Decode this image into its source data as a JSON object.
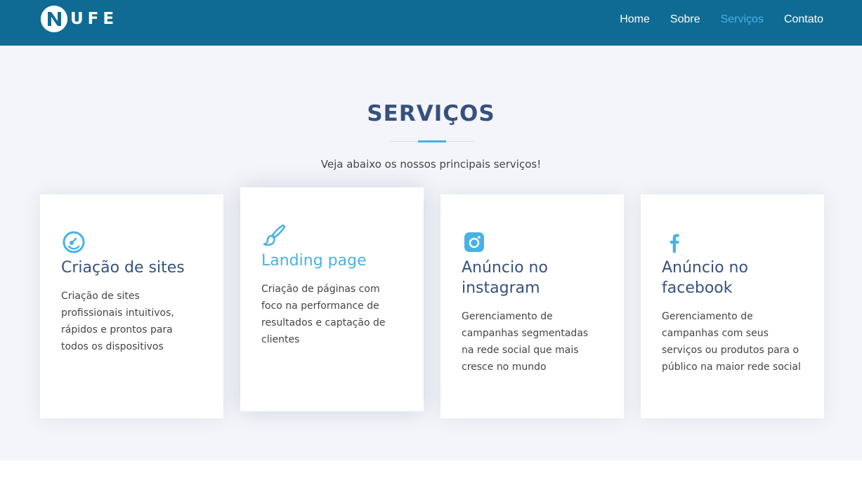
{
  "brand": {
    "name": "UFE",
    "mark_letter": "N"
  },
  "nav": {
    "items": [
      {
        "label": "Home"
      },
      {
        "label": "Sobre"
      },
      {
        "label": "Serviços",
        "active": true
      },
      {
        "label": "Contato"
      }
    ]
  },
  "services": {
    "title": "SERVIÇOS",
    "subtitle": "Veja abaixo os nossos principais serviços!",
    "cards": [
      {
        "icon": "dashboard-gauge-icon",
        "title": "Criação de sites",
        "text": "Criação de sites profissionais intuitivos, rápidos e prontos para todos os dispositivos"
      },
      {
        "icon": "paintbrush-icon",
        "title": "Landing page",
        "text": "Criação de páginas com foco na performance de resultados e captação de clientes"
      },
      {
        "icon": "instagram-icon",
        "title": "Anúncio no instagram",
        "text": "Gerenciamento de campanhas segmentadas na rede social que mais cresce no mundo"
      },
      {
        "icon": "facebook-icon",
        "title": "Anúncio no facebook",
        "text": "Gerenciamento de campanhas com seus serviços ou produtos para o público na maior rede social"
      }
    ]
  },
  "colors": {
    "header_bg": "#106b94",
    "accent": "#47b2e4",
    "heading": "#37517e",
    "section_bg": "#f3f5fa",
    "body_text": "#444444"
  }
}
